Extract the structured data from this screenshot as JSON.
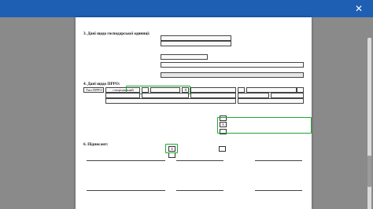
{
  "window": {
    "title": "",
    "close_glyph": "✕"
  },
  "doc": {
    "sections": {
      "s3_title": "3. Дані щодо господарської одиниці:",
      "s4_title": "4. Дані щодо ПРРО:",
      "s6_title": "6. Підписант:"
    },
    "s3": {
      "id_label": "",
      "id_value": "",
      "code_value": "",
      "koatuu_value": "",
      "name_label": "",
      "name_value": "",
      "address_label": "",
      "address_value": "",
      "extra_label": ""
    },
    "s4": {
      "type_label": "Тип ПРРО",
      "opt_stationary": "стаціонарний",
      "opt_mobile": "",
      "mark": "X",
      "opt_selfservice": "",
      "opt_internet": "",
      "name_label": "",
      "serial_label": "",
      "fiscal_label": "",
      "base_value": ""
    },
    "s5": {
      "title": "",
      "opt1": "",
      "opt2": "",
      "opt2_sub": "",
      "note": "",
      "mark": "X"
    },
    "s6": {
      "for_legal": "",
      "for_individual": "",
      "opt_head": "",
      "opt_rep": "",
      "mark": "X",
      "sig_id": "",
      "sig_name": "",
      "sig_date": "",
      "sig_caption1": "",
      "sig_caption2": "",
      "sig_caption3": ""
    }
  },
  "colors": {
    "titlebar": "#1e5fb4",
    "highlight": "#1ea832"
  }
}
